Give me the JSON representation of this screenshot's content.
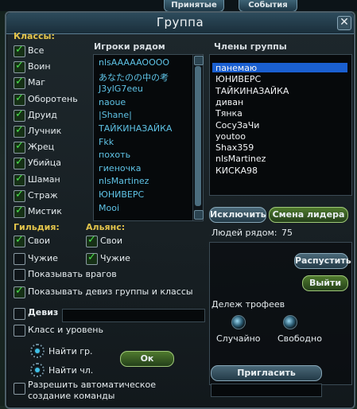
{
  "top_tabs": [
    "Принятые",
    "События"
  ],
  "window": {
    "title": "Группа"
  },
  "classes": {
    "header": "Классы:",
    "items": [
      {
        "label": "Все",
        "checked": true
      },
      {
        "label": "Воин",
        "checked": true
      },
      {
        "label": "Маг",
        "checked": true
      },
      {
        "label": "Оборотень",
        "checked": true
      },
      {
        "label": "Друид",
        "checked": true
      },
      {
        "label": "Лучник",
        "checked": true
      },
      {
        "label": "Жрец",
        "checked": true
      },
      {
        "label": "Убийца",
        "checked": true
      },
      {
        "label": "Шаман",
        "checked": true
      },
      {
        "label": "Страж",
        "checked": true
      },
      {
        "label": "Мистик",
        "checked": true
      }
    ]
  },
  "guild": {
    "header": "Гильдия:",
    "own": "Свои",
    "others": "Чужие",
    "own_checked": true,
    "others_checked": false
  },
  "alliance": {
    "header": "Альянс:",
    "own": "Свои",
    "others": "Чужие",
    "own_checked": true,
    "others_checked": true
  },
  "options": {
    "show_enemies": "Показывать врагов",
    "show_enemies_checked": false,
    "show_motto": "Показывать девиз группы и классы",
    "show_motto_checked": true,
    "motto_label": "Девиз",
    "motto_checked": false,
    "motto_value": "",
    "class_level": "Класс и уровень",
    "class_level_checked": false,
    "auto_create": "Разрешить автоматическое создание команды",
    "auto_create_checked": false
  },
  "find": {
    "group": "Найти гр.",
    "member": "Найти чл."
  },
  "ok_button": "Ок",
  "nearby": {
    "header": "Игроки рядом",
    "players": [
      "nlsAAAAAOOOO",
      "あなたのの中の考",
      "J3ylG7eeu",
      "naoue",
      "|Shane|",
      "ТАЙКИНАЗАЙКА",
      "Fkk",
      "похоть",
      "гиеночка",
      "nlsMartinez",
      "ЮНИВЕРС",
      "Mooi"
    ]
  },
  "members": {
    "header": "Члены группы",
    "list": [
      "панемаю",
      "ЮНИВЕРС",
      "ТАЙКИНАЗАЙКА",
      "диван",
      "Тянка",
      "СосуЗаЧи",
      "youtoo",
      "Shax359",
      "nlsMartinez",
      "КИСКА98"
    ],
    "selected_index": 0
  },
  "buttons": {
    "kick": "Исключить",
    "change_leader": "Смена лидера",
    "disband": "Распустить",
    "leave": "Выйти",
    "invite": "Пригласить"
  },
  "people_nearby": {
    "label": "Людей рядом:",
    "count": "75"
  },
  "loot": {
    "header": "Дележ трофеев",
    "random": "Случайно",
    "free": "Свободно"
  },
  "invite_value": ""
}
